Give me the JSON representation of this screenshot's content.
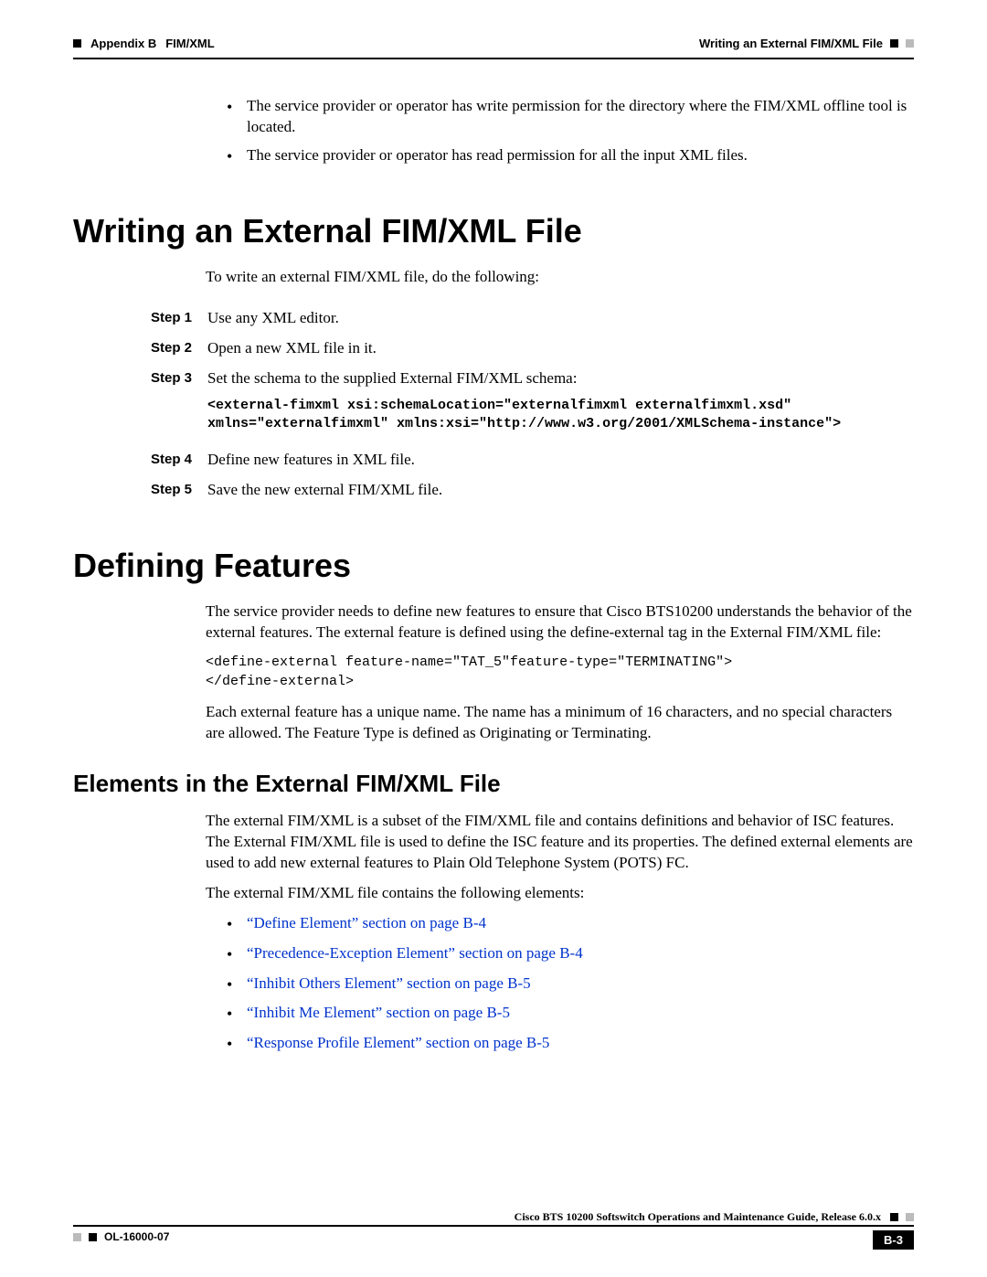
{
  "header": {
    "appendix_label": "Appendix B",
    "appendix_title": "FIM/XML",
    "section_label": "Writing an External FIM/XML File"
  },
  "intro_bullets": [
    "The service provider or operator has write permission for the directory where the FIM/XML offline tool is located.",
    "The service provider or operator has read permission for all the input XML files."
  ],
  "section_writing": {
    "title": "Writing an External FIM/XML File",
    "intro": "To write an external FIM/XML file, do the following:",
    "steps": [
      {
        "label": "Step 1",
        "text": "Use any XML editor."
      },
      {
        "label": "Step 2",
        "text": "Open a new XML file in it."
      },
      {
        "label": "Step 3",
        "text": "Set the schema to the supplied External FIM/XML schema:",
        "code": "<external-fimxml xsi:schemaLocation=\"externalfimxml externalfimxml.xsd\"\nxmlns=\"externalfimxml\" xmlns:xsi=\"http://www.w3.org/2001/XMLSchema-instance\">"
      },
      {
        "label": "Step 4",
        "text": "Define new features in XML file."
      },
      {
        "label": "Step 5",
        "text": "Save the new external FIM/XML file."
      }
    ]
  },
  "section_defining": {
    "title": "Defining Features",
    "p1": "The service provider needs to define new features to ensure that Cisco BTS10200 understands the behavior of the external features. The external feature is defined using the define-external tag in the External FIM/XML file:",
    "code": "<define-external feature-name=\"TAT_5\"feature-type=\"TERMINATING\">\n</define-external>",
    "p2": "Each external feature has a unique name. The name has a minimum of 16 characters, and no special characters are allowed. The Feature Type is defined as Originating or Terminating."
  },
  "section_elements": {
    "title": "Elements in the External FIM/XML File",
    "p1": "The external FIM/XML is a subset of the FIM/XML file and contains definitions and behavior of ISC features. The External FIM/XML file is used to define the ISC feature and its properties. The defined external elements are used to add new external features to Plain Old Telephone System (POTS) FC.",
    "p2": "The external FIM/XML file contains the following elements:",
    "links": [
      "“Define Element” section on page B-4",
      "“Precedence-Exception Element” section on page B-4",
      "“Inhibit Others Element” section on page B-5",
      "“Inhibit Me Element” section on page B-5",
      "“Response Profile Element” section on page B-5"
    ]
  },
  "footer": {
    "doc_title": "Cisco BTS 10200 Softswitch Operations and Maintenance Guide, Release 6.0.x",
    "doc_id": "OL-16000-07",
    "page_number": "B-3"
  }
}
